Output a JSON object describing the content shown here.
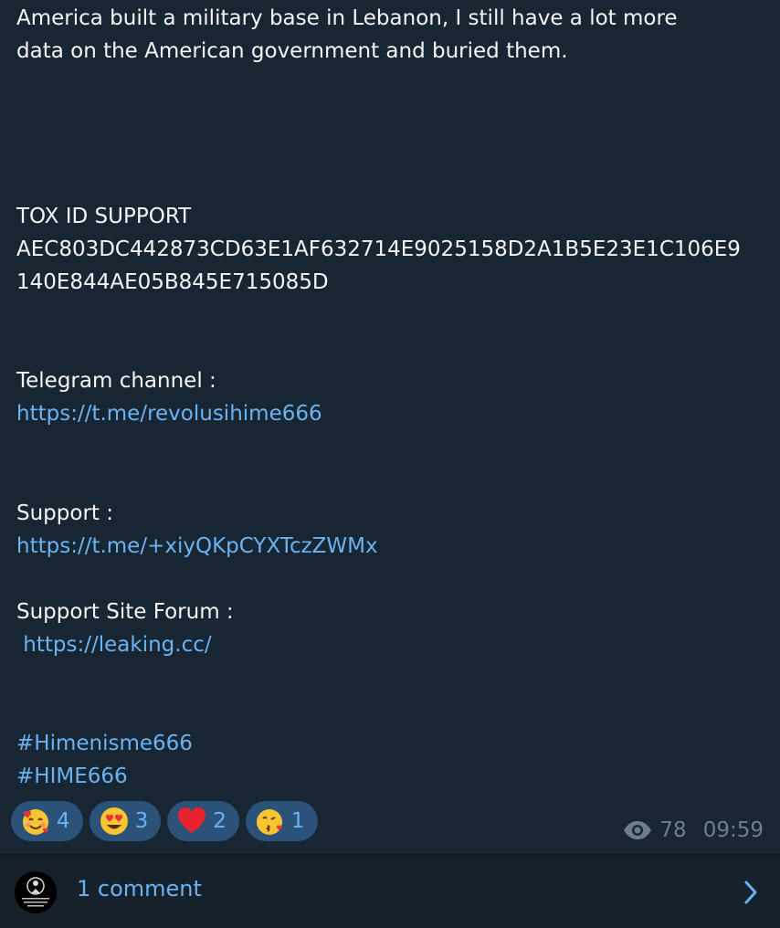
{
  "message": {
    "line1": "America built a military base in Lebanon, I still have a lot more",
    "line2": "data on the American government and buried them.",
    "tox_heading": "TOX ID SUPPORT",
    "tox_id_line1": "AEC803DC442873CD63E1AF632714E9025158D2A1B5E23E1C106E9",
    "tox_id_line2": "140E844AE05B845E715085D",
    "telegram_label": "Telegram channel :",
    "telegram_link": "https://t.me/revolusihime666",
    "support_label": "Support  :",
    "support_link": "https://t.me/+xiyQKpCYXTczZWMx",
    "forum_label": "Support Site Forum  :",
    "forum_link": " https://leaking.cc/",
    "hashtag1": "#Himenisme666",
    "hashtag2": "#HIME666"
  },
  "reactions": [
    {
      "emoji": "smiling-face-with-hearts",
      "count": "4"
    },
    {
      "emoji": "heart-eyes",
      "count": "3"
    },
    {
      "emoji": "red-heart",
      "count": "2"
    },
    {
      "emoji": "face-blowing-kiss",
      "count": "1"
    }
  ],
  "meta": {
    "views": "78",
    "time": "09:59"
  },
  "comments": {
    "label": "1 comment"
  },
  "colors": {
    "background": "#17212b",
    "link": "#6ab3f3",
    "reaction_bg": "#2b5278",
    "meta": "#6d7f8f"
  }
}
